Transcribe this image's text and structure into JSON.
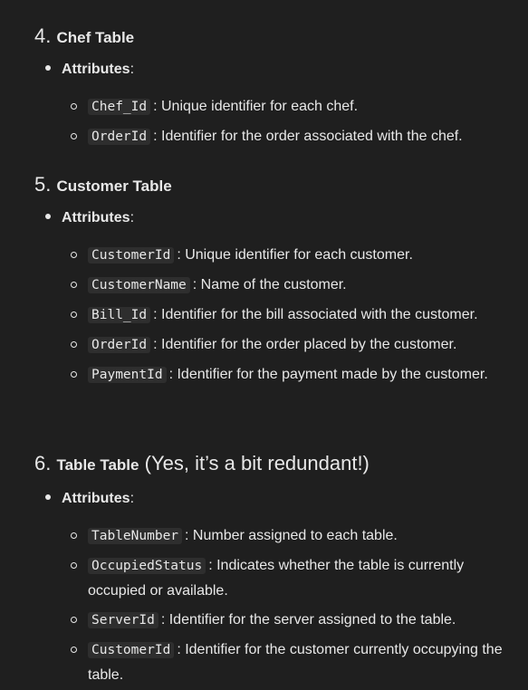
{
  "sections": [
    {
      "number": "4.",
      "title": "Chef Table",
      "extra": "",
      "attributes_label": "Attributes",
      "items": [
        {
          "code": "Chef_Id",
          "text": ": Unique identifier for each chef."
        },
        {
          "code": "OrderId",
          "text": ": Identifier for the order associated with the chef."
        }
      ]
    },
    {
      "number": "5.",
      "title": "Customer Table",
      "extra": "",
      "attributes_label": "Attributes",
      "items": [
        {
          "code": "CustomerId",
          "text": ": Unique identifier for each customer."
        },
        {
          "code": "CustomerName",
          "text": ": Name of the customer."
        },
        {
          "code": "Bill_Id",
          "text": ": Identifier for the bill associated with the customer."
        },
        {
          "code": "OrderId",
          "text": ": Identifier for the order placed by the customer."
        },
        {
          "code": "PaymentId",
          "text": ": Identifier for the payment made by the customer."
        }
      ]
    },
    {
      "number": "6.",
      "title": "Table Table",
      "extra": "(Yes, it’s a bit redundant!)",
      "attributes_label": "Attributes",
      "items": [
        {
          "code": "TableNumber",
          "text": ": Number assigned to each table."
        },
        {
          "code": "OccupiedStatus",
          "text": ": Indicates whether the table is currently occupied or available."
        },
        {
          "code": "ServerId",
          "text": ": Identifier for the server assigned to the table."
        },
        {
          "code": "CustomerId",
          "text": ": Identifier for the customer currently occupying the table."
        }
      ]
    }
  ]
}
